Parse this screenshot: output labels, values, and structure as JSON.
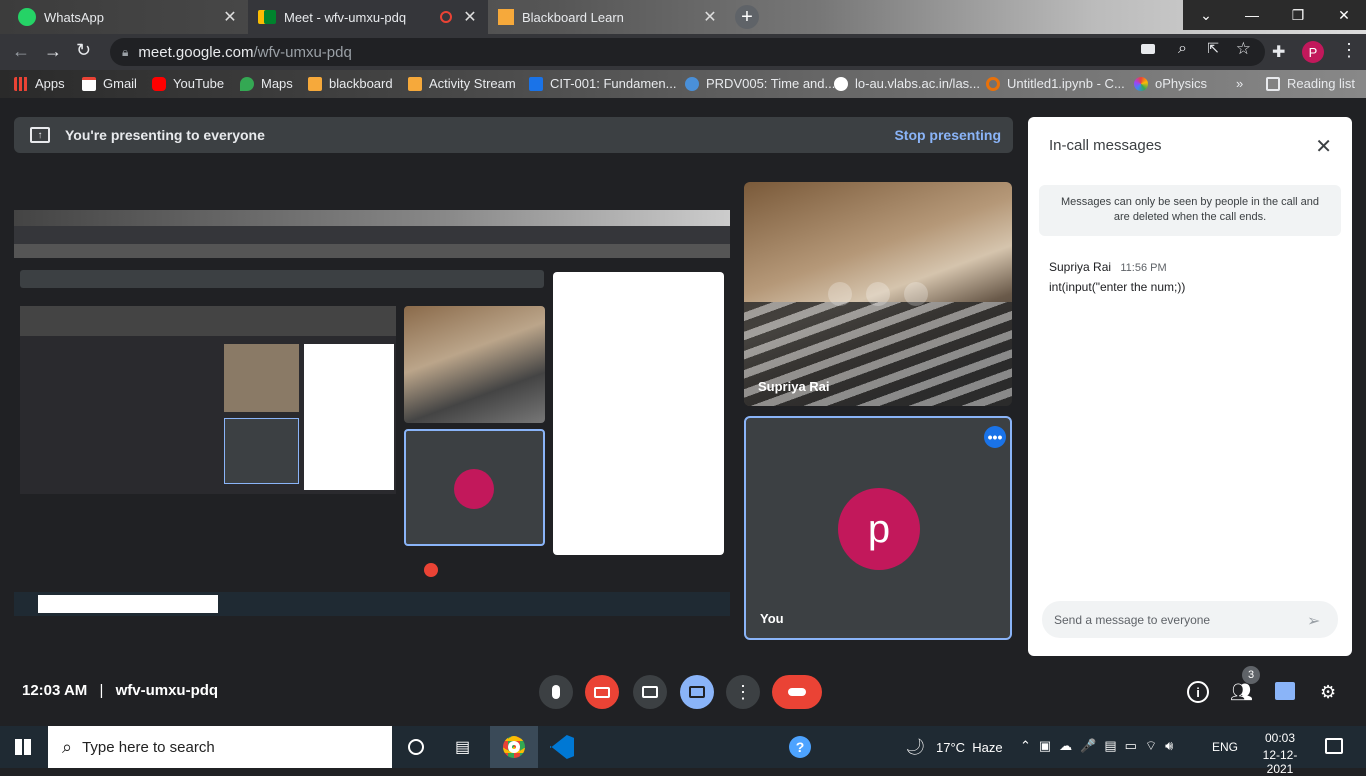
{
  "browser": {
    "tabs": [
      {
        "label": "WhatsApp",
        "icon": "whatsapp-icon",
        "active": false
      },
      {
        "label": "Meet - wfv-umxu-pdq",
        "icon": "meet-icon",
        "active": true
      },
      {
        "label": "Blackboard Learn",
        "icon": "blackboard-icon",
        "active": false
      }
    ],
    "url_host": "meet.google.com",
    "url_path": "/wfv-umxu-pdq",
    "profile_initial": "P",
    "bookmarks": [
      {
        "label": "Apps",
        "color": "#ea4335"
      },
      {
        "label": "Gmail",
        "color": "#ea4335"
      },
      {
        "label": "YouTube",
        "color": "#ff0000"
      },
      {
        "label": "Maps",
        "color": "#34a853"
      },
      {
        "label": "blackboard",
        "color": "#f6a93b"
      },
      {
        "label": "Activity Stream",
        "color": "#f6a93b"
      },
      {
        "label": "CIT-001: Fundamen...",
        "color": "#1a73e8"
      },
      {
        "label": "PRDV005: Time and...",
        "color": "#4a90d9"
      },
      {
        "label": "lo-au.vlabs.ac.in/las...",
        "color": "#ffffff"
      },
      {
        "label": "Untitled1.ipynb - C...",
        "color": "#e8710a"
      },
      {
        "label": "oPhysics",
        "color": "#a142f4"
      }
    ],
    "more_label": "»",
    "reading_list": "Reading list"
  },
  "meet": {
    "presenting_text": "You're presenting to everyone",
    "stop_presenting": "Stop presenting",
    "participants": [
      {
        "name": "Supriya Rai"
      },
      {
        "name": "You",
        "initial": "p",
        "avatar_color": "#c2185b"
      }
    ],
    "panel": {
      "title": "In-call messages",
      "notice": "Messages can only be seen by people in the call and are deleted when the call ends.",
      "message": {
        "sender": "Supriya Rai",
        "time": "11:56 PM",
        "text": "int(input(\"enter the num;))"
      },
      "input_placeholder": "Send a message to everyone"
    },
    "time": "12:03 AM",
    "separator": "|",
    "meeting_code": "wfv-umxu-pdq",
    "people_count": "3"
  },
  "taskbar": {
    "search_placeholder": "Type here to search",
    "weather": "17°C  Haze",
    "language": "ENG",
    "clock_time": "00:03",
    "clock_date": "12-12-2021"
  },
  "colors": {
    "accent": "#8ab4f8",
    "end_call": "#ea4335",
    "avatar": "#c2185b"
  }
}
